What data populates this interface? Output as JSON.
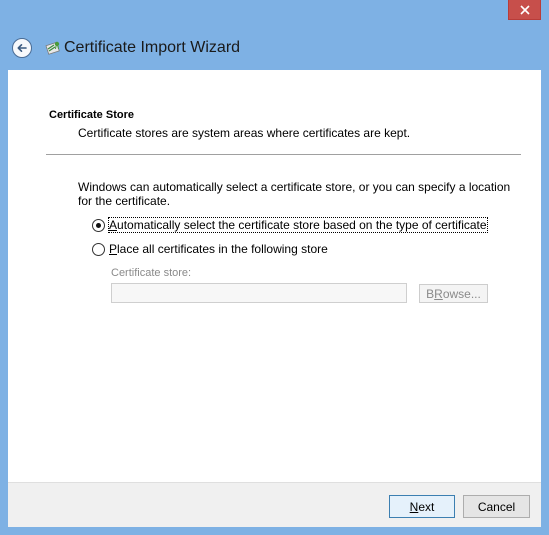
{
  "window": {
    "title": "Certificate Import Wizard",
    "close_label": "Close",
    "back_label": "Back",
    "frame_color": "#7eb1e4",
    "close_color": "#c74f4b"
  },
  "page": {
    "heading": "Certificate Store",
    "description": "Certificate stores are system areas where certificates are kept.",
    "info": "Windows can automatically select a certificate store, or you can specify a location for the certificate."
  },
  "options": {
    "auto": {
      "mnemonic": "A",
      "rest": "utomatically select the certificate store based on the type of certificate",
      "checked": true
    },
    "manual": {
      "mnemonic": "P",
      "rest": "lace all certificates in the following store",
      "checked": false
    }
  },
  "store": {
    "label": "Certificate store:",
    "value": "",
    "browse_mnemonic": "R",
    "browse_prefix": "B",
    "browse_rest": "owse..."
  },
  "footer": {
    "next_mnemonic": "N",
    "next_rest": "ext",
    "cancel_label": "Cancel"
  }
}
